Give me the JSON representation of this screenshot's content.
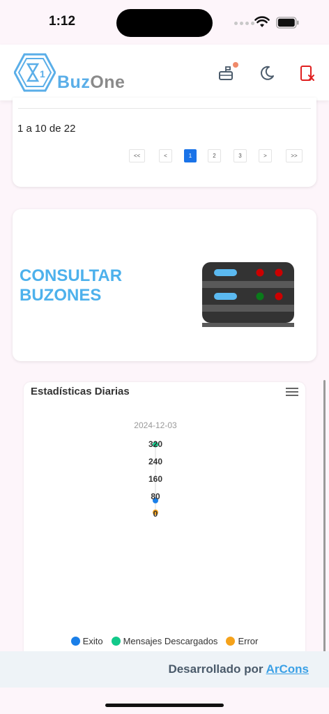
{
  "status_bar": {
    "time": "1:12"
  },
  "header": {
    "brand_left": "Buz",
    "brand_right": "One",
    "accent": "#5aaee8"
  },
  "pagination": {
    "range_text": "1 a 10 de 22",
    "buttons": [
      "<<",
      "<",
      "1",
      "2",
      "3",
      ">",
      ">>"
    ],
    "current": "1"
  },
  "consultar": {
    "title_line1": "CONSULTAR",
    "title_line2": "BUZONES",
    "icon": "server-icon"
  },
  "stats": {
    "title": "Estadísticas Diarias",
    "menu_icon": "hamburger-menu-icon"
  },
  "chart_data": {
    "type": "scatter",
    "title": "Estadísticas Diarias",
    "categories": [
      "2024-12-03"
    ],
    "yticks": [
      0,
      80,
      160,
      240,
      320
    ],
    "ylim": [
      0,
      320
    ],
    "series": [
      {
        "name": "Exito",
        "color": "#1a7fe8",
        "values": [
          58
        ]
      },
      {
        "name": "Mensajes Descargados",
        "color": "#12c98a",
        "values": [
          315
        ]
      },
      {
        "name": "Error",
        "color": "#f5a21b",
        "values": [
          4
        ]
      }
    ],
    "legend": "bottom"
  },
  "footer": {
    "prefix": "Desarrollado por ",
    "link": "ArCons"
  }
}
